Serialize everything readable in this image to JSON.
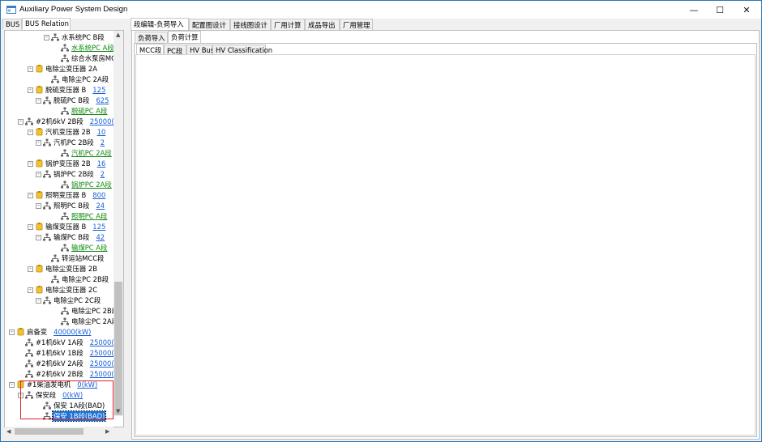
{
  "window": {
    "title": "Auxiliary Power System Design",
    "minimize": "—",
    "maximize": "☐",
    "close": "✕"
  },
  "left_tabs": [
    "BUS",
    "BUS Relation"
  ],
  "main_tabs": [
    "段编辑-负荷导入",
    "配置图设计",
    "接线图设计",
    "厂用计算",
    "成品导出",
    "厂用管理"
  ],
  "sub_tabs": [
    "负荷导入",
    "负荷计算"
  ],
  "inner_tabs": [
    "MCC段",
    "PC段",
    "HV Bus",
    "HV Classification"
  ],
  "tree": [
    {
      "label": "水系统PC B段",
      "value": "",
      "icon": "bus",
      "pm": "-"
    },
    {
      "label": "水系统PC A段",
      "value": "",
      "icon": "bus",
      "pm": "",
      "style": "green"
    },
    {
      "label": "综合水泵房MC",
      "value": "",
      "icon": "bus",
      "pm": ""
    },
    {
      "label": "电除尘变压器 2A",
      "value": "",
      "icon": "transformer",
      "pm": "-"
    },
    {
      "label": "电除尘PC 2A段",
      "value": "",
      "icon": "bus",
      "pm": ""
    },
    {
      "label": "脱硫变压器 B",
      "value": "125",
      "icon": "transformer",
      "pm": "-"
    },
    {
      "label": "脱硫PC B段",
      "value": "625",
      "icon": "bus",
      "pm": "-"
    },
    {
      "label": "脱硫PC A段",
      "value": "",
      "icon": "bus",
      "pm": "",
      "style": "green"
    },
    {
      "label": "#2机6kV 2B段",
      "value": "25000(",
      "icon": "bus",
      "pm": "-"
    },
    {
      "label": "汽机变压器 2B",
      "value": "10",
      "icon": "transformer",
      "pm": "-"
    },
    {
      "label": "汽机PC 2B段",
      "value": "2",
      "icon": "bus",
      "pm": "-"
    },
    {
      "label": "汽机PC 2A段",
      "value": "",
      "icon": "bus",
      "pm": "",
      "style": "green"
    },
    {
      "label": "锅炉变压器 2B",
      "value": "16",
      "icon": "transformer",
      "pm": "-"
    },
    {
      "label": "锅炉PC 2B段",
      "value": "2",
      "icon": "bus",
      "pm": "-"
    },
    {
      "label": "锅炉PC 2A段",
      "value": "",
      "icon": "bus",
      "pm": "",
      "style": "green"
    },
    {
      "label": "照明变压器 B",
      "value": "800",
      "icon": "transformer",
      "pm": "-"
    },
    {
      "label": "照明PC B段",
      "value": "24",
      "icon": "bus",
      "pm": "-"
    },
    {
      "label": "照明PC A段",
      "value": "",
      "icon": "bus",
      "pm": "",
      "style": "green"
    },
    {
      "label": "输煤变压器 B",
      "value": "125",
      "icon": "transformer",
      "pm": "-"
    },
    {
      "label": "输煤PC B段",
      "value": "42",
      "icon": "bus",
      "pm": "-"
    },
    {
      "label": "输煤PC A段",
      "value": "",
      "icon": "bus",
      "pm": "",
      "style": "green"
    },
    {
      "label": "转运站MCC段",
      "value": "",
      "icon": "bus",
      "pm": ""
    },
    {
      "label": "电除尘变压器 2B",
      "value": "",
      "icon": "transformer",
      "pm": "-"
    },
    {
      "label": "电除尘PC 2B段",
      "value": "",
      "icon": "bus",
      "pm": ""
    },
    {
      "label": "电除尘变压器 2C",
      "value": "",
      "icon": "transformer",
      "pm": "-"
    },
    {
      "label": "电除尘PC 2C段",
      "value": "",
      "icon": "bus",
      "pm": "-"
    },
    {
      "label": "电除尘PC 2B段",
      "value": "",
      "icon": "bus",
      "pm": ""
    },
    {
      "label": "电除尘PC 2A段",
      "value": "",
      "icon": "bus",
      "pm": ""
    },
    {
      "label": "启备变",
      "value": "40000(kW)",
      "icon": "transformer",
      "pm": "-"
    },
    {
      "label": "#1机6kV 1A段",
      "value": "25000(",
      "icon": "bus",
      "pm": ""
    },
    {
      "label": "#1机6kV 1B段",
      "value": "25000(",
      "icon": "bus",
      "pm": ""
    },
    {
      "label": "#2机6kV 2A段",
      "value": "25000(",
      "icon": "bus",
      "pm": ""
    },
    {
      "label": "#2机6kV 2B段",
      "value": "25000(",
      "icon": "bus",
      "pm": ""
    },
    {
      "label": "#1柴油发电机",
      "value": "0(kW)",
      "icon": "transformer",
      "pm": "-"
    },
    {
      "label": "保安段",
      "value": "0(kW)",
      "icon": "bus",
      "pm": "-"
    },
    {
      "label": "保安 1A段(BAD)",
      "value": "",
      "icon": "bus",
      "pm": ""
    },
    {
      "label": "保安 1B段(BAD)",
      "value": "",
      "icon": "bus",
      "pm": "",
      "style": "selected"
    }
  ],
  "colors": {
    "accent": "#1874d9",
    "link": "#1a5fd6",
    "green_link": "#118811",
    "highlight_box": "#e0212b"
  }
}
